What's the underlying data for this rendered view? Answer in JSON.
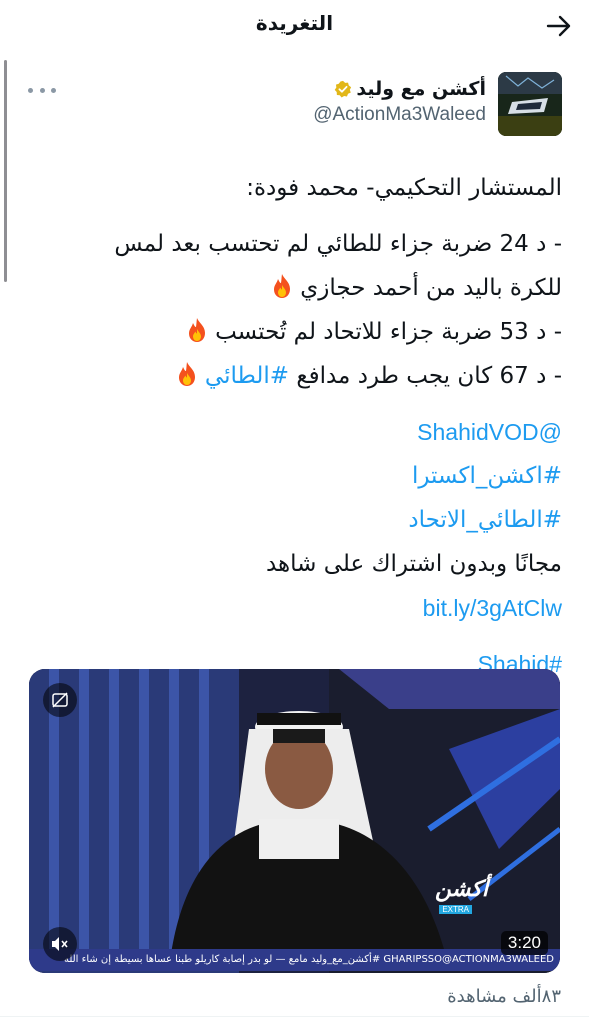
{
  "header": {
    "title": "التغريدة",
    "back_icon": "arrow-right-icon"
  },
  "tweet": {
    "author_name": "أكشن مع وليد",
    "handle": "@ActionMa3Waleed",
    "verified": true,
    "more_icon": "more-horizontal-icon",
    "lines": {
      "l1": "المستشار التحكيمي- محمد فودة:",
      "l2": "- د 24 ضربة جزاء للطائي لم تحتسب بعد لمس",
      "l3": "للكرة باليد من أحمد حجازي",
      "l4": "- د 53 ضربة جزاء للاتحاد لم تُحتسب",
      "l5_text": "- د 67 كان يجب طرد مدافع",
      "l5_tag": "#الطائي",
      "mention": "@ShahidVOD",
      "tag1": "#اكشن_اكسترا",
      "tag2": "#الطائي_الاتحاد",
      "free_text": "مجانًا وبدون اشتراك على شاهد",
      "link": "bit.ly/3gAtClw",
      "tag3": "#Shahid"
    }
  },
  "media": {
    "duration": "3:20",
    "ticker": "GHARIPSSO@ACTIONMA3WALEED  #أكشن_مع_وليد مامع — لو بدر إصابة كاريلو طبنا عساها بسيطة إن شاء الله",
    "brand": "أكشن",
    "brand_sub": "EXTRA",
    "mute_icon": "volume-mute-icon",
    "sensitive_icon": "hide-media-icon"
  },
  "views": "٨٣ألف مشاهدة",
  "colors": {
    "link": "#1d9bf0",
    "text": "#0f1419",
    "secondary": "#536471",
    "verified": "#e2b719"
  }
}
